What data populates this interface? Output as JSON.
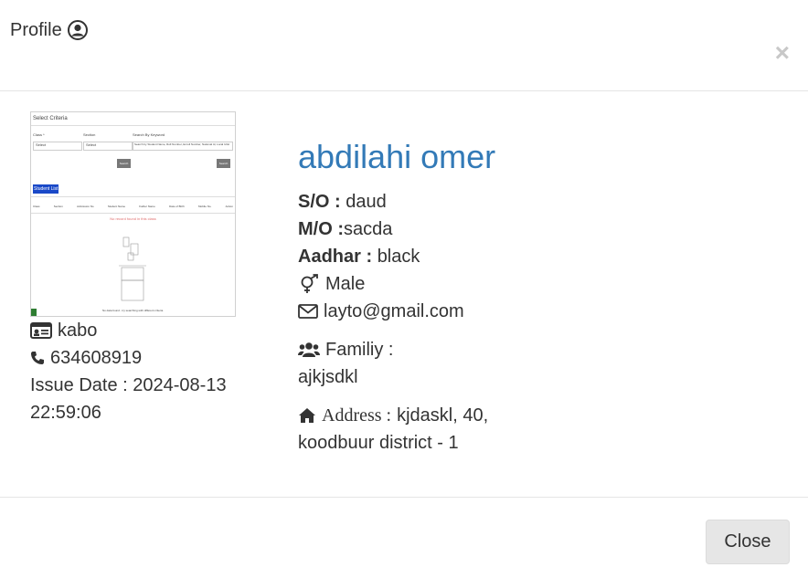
{
  "header": {
    "title": "Profile",
    "close_symbol": "×"
  },
  "photo": {
    "select_criteria": "Select Criteria",
    "class_label": "Class *",
    "section_label": "Section",
    "keyword_label": "Search By Keyword",
    "class_select": "Select",
    "section_select": "Select",
    "keyword_placeholder": "Search by Student Name, Roll Number, Enroll Number, National Id, Local Id Etc.",
    "search_btn_1": "Search",
    "search_btn_2": "Search",
    "student_list_tab": "Student List",
    "table_headers": [
      "Class",
      "Section",
      "Admission No",
      "Student Name",
      "Father Name",
      "Date of Birth",
      "Mobile No.",
      "Action"
    ],
    "no_records": "No record found in this class",
    "footer_text": "No data found - try searching with different criteria"
  },
  "left": {
    "id_card_value": "kabo",
    "phone": "634608919",
    "issue_label": "Issue Date : 2024-08-13",
    "issue_time": "22:59:06"
  },
  "right": {
    "name": "abdilahi omer",
    "so_label": "S/O :",
    "so_value": "daud",
    "mo_label": "M/O :",
    "mo_value": "sacda",
    "aadhar_label": "Aadhar :",
    "aadhar_value": "black",
    "gender": "Male",
    "email": "layto@gmail.com",
    "family_label": "Familiy :",
    "family_value": "ajkjsdkl",
    "address_label": "Address :",
    "address_line1": "kjdaskl, 40,",
    "address_line2": "koodbuur district - 1"
  },
  "footer": {
    "close_label": "Close"
  },
  "colors": {
    "name_blue": "#337ab7",
    "tab_blue": "#1a49c8",
    "close_btn_bg": "#e6e6e6"
  },
  "icons": [
    "user-circle-icon",
    "close-icon",
    "id-card-icon",
    "phone-icon",
    "gender-icon",
    "envelope-icon",
    "users-icon",
    "home-icon"
  ]
}
